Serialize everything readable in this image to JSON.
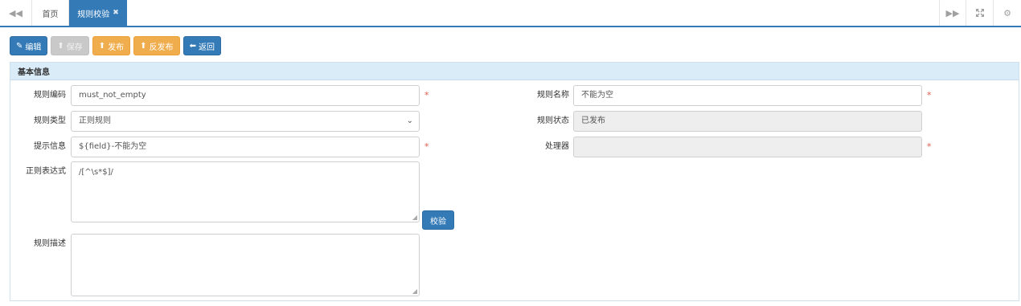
{
  "tabs": {
    "home_label": "首页",
    "active_label": "规则校验",
    "close_glyph": "✖",
    "nav_left_icon": "double-chevron-left-icon",
    "nav_right_icon": "double-chevron-right-icon",
    "expand_icon": "fullscreen-icon",
    "settings_icon": "gear-icon"
  },
  "toolbar": {
    "edit_label": "编辑",
    "save_label": "保存",
    "publish_label": "发布",
    "unpublish_label": "反发布",
    "back_label": "返回"
  },
  "panel": {
    "title": "基本信息"
  },
  "form": {
    "rule_code": {
      "label": "规则编码",
      "value": "must_not_empty",
      "required_mark": "*"
    },
    "rule_name": {
      "label": "规则名称",
      "value": "不能为空",
      "required_mark": "*"
    },
    "rule_type": {
      "label": "规则类型",
      "value": "正则规则"
    },
    "rule_status": {
      "label": "规则状态",
      "value": "已发布"
    },
    "message": {
      "label": "提示信息",
      "value": "${field}-不能为空",
      "required_mark": "*"
    },
    "handler": {
      "label": "处理器",
      "value": "",
      "required_mark": "*"
    },
    "regex": {
      "label": "正则表达式",
      "value": "/[^\\s*$]/"
    },
    "verify_label": "校验",
    "description": {
      "label": "规则描述",
      "value": ""
    }
  },
  "colors": {
    "primary": "#337ab7",
    "warning": "#f0ad4e",
    "disabled": "#c9c9c9",
    "required": "#e05b4a",
    "panel_header": "#d9ecf8"
  }
}
